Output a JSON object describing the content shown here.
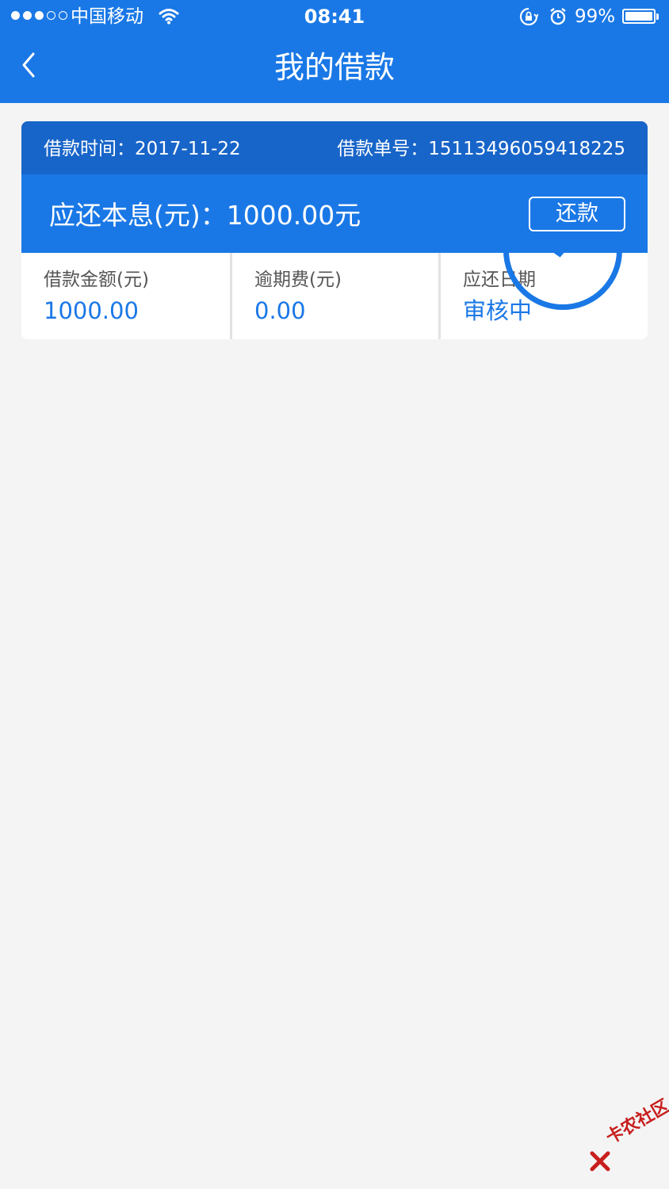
{
  "status_bar": {
    "carrier": "中国移动",
    "time": "08:41",
    "battery_percent": "99%",
    "signal_bars_filled": 3,
    "signal_bars_total": 5
  },
  "nav": {
    "title": "我的借款",
    "back_icon": "chevron-left-icon"
  },
  "loan": {
    "date_text": "借款时间：2017-11-22",
    "order_text": "借款单号：15113496059418225",
    "repay_amount_text": "应还本息(元)：1000.00元",
    "repay_button": "还款",
    "fields": [
      {
        "label": "借款金额(元)",
        "value": "1000.00"
      },
      {
        "label": "逾期费(元)",
        "value": "0.00"
      },
      {
        "label": "应还日期",
        "value": "审核中"
      }
    ]
  },
  "watermark": {
    "text": "卡农社区"
  },
  "colors": {
    "primary": "#1a78e6",
    "header_dark": "#1865c9",
    "background": "#f4f4f4",
    "watermark": "#c81e1e"
  }
}
